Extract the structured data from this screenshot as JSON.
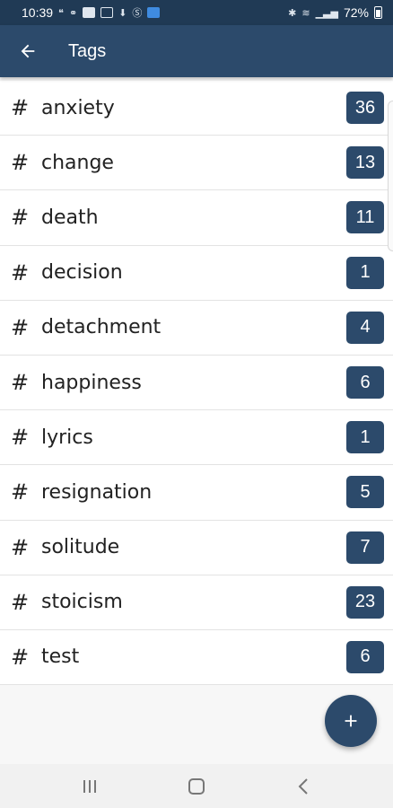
{
  "status_bar": {
    "time": "10:39",
    "battery": "72%"
  },
  "app_bar": {
    "title": "Tags"
  },
  "tag_symbol": "#",
  "tags": [
    {
      "name": "anxiety",
      "count": "36"
    },
    {
      "name": "change",
      "count": "13"
    },
    {
      "name": "death",
      "count": "11"
    },
    {
      "name": "decision",
      "count": "1"
    },
    {
      "name": "detachment",
      "count": "4"
    },
    {
      "name": "happiness",
      "count": "6"
    },
    {
      "name": "lyrics",
      "count": "1"
    },
    {
      "name": "resignation",
      "count": "5"
    },
    {
      "name": "solitude",
      "count": "7"
    },
    {
      "name": "stoicism",
      "count": "23"
    },
    {
      "name": "test",
      "count": "6"
    }
  ],
  "colors": {
    "primary": "#2c4a6b",
    "status_bar": "#203a55",
    "badge": "#2c4a6b"
  }
}
